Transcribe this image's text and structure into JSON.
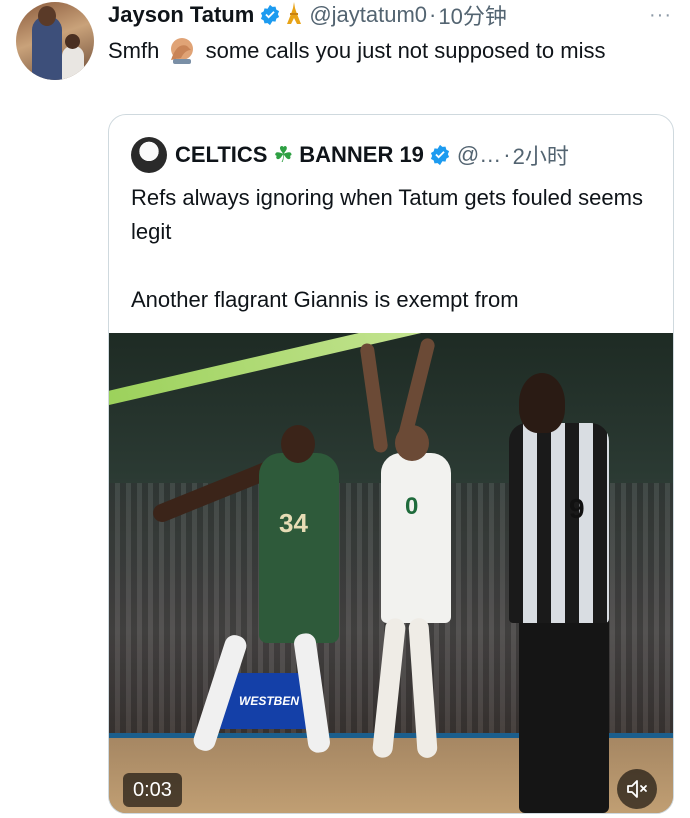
{
  "tweet": {
    "author_name": "Jayson Tatum",
    "handle": "@jaytatum0",
    "separator": "·",
    "time": "10分钟",
    "text_before_emoji": "Smfh",
    "text_after_emoji": " some calls you just not supposed to miss",
    "more_label": "···"
  },
  "quote": {
    "author_name": "CELTICS",
    "clover": "☘",
    "author_name_2": "BANNER 19",
    "handle": "@…",
    "separator": "·",
    "time": "2小时",
    "text_line_1": "Refs always ignoring when Tatum gets fouled seems legit",
    "text_line_2": "Another flagrant Giannis is exempt from",
    "video": {
      "time": "0:03",
      "ad_text": "WESTBEN",
      "jersey_green": "34",
      "jersey_white": "0",
      "ref_number": "9"
    }
  },
  "colors": {
    "verified_blue": "#1d9bf0",
    "handle_gray": "#536471",
    "border": "#cfd9de",
    "clover_green": "#2ea043"
  },
  "icons": [
    "verified-badge-icon",
    "eiffel-tower-emoji",
    "facepalm-emoji",
    "more-icon",
    "clover-emoji",
    "mute-icon"
  ]
}
